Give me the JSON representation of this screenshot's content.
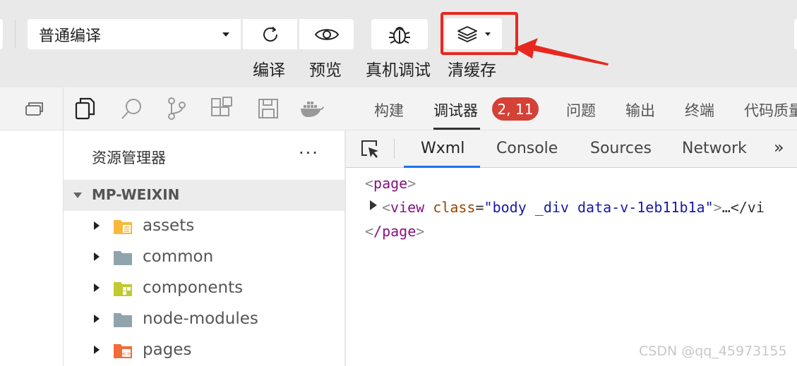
{
  "toolbar": {
    "compile_mode": "普通编译",
    "labels": {
      "compile": "编译",
      "preview": "预览",
      "remote_debug": "真机调试",
      "clear_cache": "清缓存"
    },
    "icons": [
      "refresh-icon",
      "eye-icon",
      "bug-icon",
      "layers-icon"
    ],
    "highlight_color": "#e8281e"
  },
  "activity_bar": {
    "icons": [
      "window-restore-icon",
      "files-icon",
      "search-icon",
      "source-control-icon",
      "extensions-icon",
      "save-icon",
      "docker-icon"
    ]
  },
  "panel_tabs": {
    "items": [
      "构建",
      "调试器",
      "问题",
      "输出",
      "终端",
      "代码质量"
    ],
    "active": "调试器",
    "badge": "2, 11",
    "badge_color": "#d44136"
  },
  "explorer": {
    "title": "资源管理器",
    "more": "···",
    "project": "MP-WEIXIN",
    "items": [
      {
        "label": "assets",
        "color": "#f6b93b"
      },
      {
        "label": "common",
        "color": "#90a4ae"
      },
      {
        "label": "components",
        "color": "#c0ca33"
      },
      {
        "label": "node-modules",
        "color": "#90a4ae"
      },
      {
        "label": "pages",
        "color": "#f26b3a"
      }
    ]
  },
  "devtools": {
    "tabs": [
      "Wxml",
      "Console",
      "Sources",
      "Network"
    ],
    "active": "Wxml",
    "more": "»",
    "accent": "#1a73e8",
    "code": {
      "line1_tag": "page",
      "line2_tag": "view",
      "line2_attr": "class",
      "line2_value": "\"body _div data-v-1eb11b1a\"",
      "line2_tail": "…</vi",
      "line3_tag": "/page"
    }
  },
  "watermark": "CSDN @qq_45973155"
}
